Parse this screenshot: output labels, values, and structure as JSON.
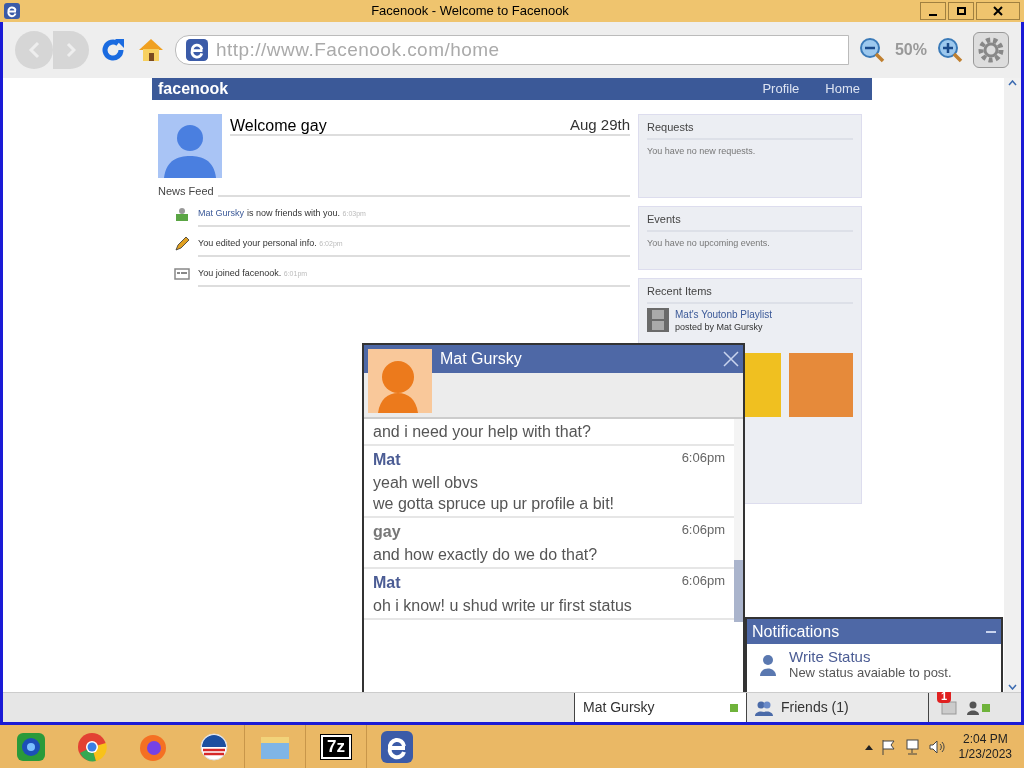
{
  "window": {
    "title": "Facenook - Welcome to Facenook"
  },
  "browser": {
    "url": "http://www.Facenook.com/home",
    "zoom": "50%"
  },
  "site": {
    "logo": "facenook",
    "nav": [
      "Profile",
      "Home"
    ]
  },
  "profile": {
    "greeting": "Welcome gay",
    "date": "Aug 29th"
  },
  "news_feed": {
    "title": "News Feed",
    "items": [
      {
        "kind": "friend",
        "link": "Mat Gursky",
        "text": "is now friends with you.",
        "time": "6:03pm"
      },
      {
        "kind": "edit",
        "text": "You edited your personal info.",
        "time": "6:02pm"
      },
      {
        "kind": "join",
        "text": "You joined facenook.",
        "time": "6:01pm"
      }
    ]
  },
  "sidebar": [
    {
      "title": "Requests",
      "text": "You have no new requests."
    },
    {
      "title": "Events",
      "text": "You have no upcoming events."
    }
  ],
  "recent_items": {
    "title": "Recent Items",
    "items": [
      {
        "title": "Mat's Youtonb Playlist",
        "byline": "posted by Mat Gursky"
      }
    ]
  },
  "chat": {
    "name": "Mat Gursky",
    "messages": [
      {
        "lines": [
          "and i need your help with that?"
        ]
      },
      {
        "sender": "Mat",
        "self": false,
        "time": "6:06pm",
        "lines": [
          "yeah well obvs",
          "we gotta spruce up ur profile a bit!"
        ]
      },
      {
        "sender": "gay",
        "self": true,
        "time": "6:06pm",
        "lines": [
          "and how exactly do we do that?"
        ]
      },
      {
        "sender": "Mat",
        "self": false,
        "time": "6:06pm",
        "lines": [
          "oh i know! u shud write ur first status"
        ]
      }
    ]
  },
  "notifications": {
    "title": "Notifications",
    "items": [
      {
        "title": "Write Status",
        "text": "New status avaiable to post."
      }
    ]
  },
  "bottom_bar": {
    "chat_tab": {
      "name": "Mat Gursky",
      "online": true
    },
    "friends": "Friends (1)",
    "badge": "1",
    "online": true
  },
  "taskbar": {
    "apps": [
      {
        "kind": "ball"
      },
      {
        "kind": "chrome"
      },
      {
        "kind": "firefox"
      },
      {
        "kind": "obama"
      },
      {
        "kind": "folder"
      },
      {
        "kind": "archive",
        "label": "7z"
      },
      {
        "kind": "browser"
      }
    ],
    "time": "2:04 PM",
    "date": "1/23/2023"
  }
}
